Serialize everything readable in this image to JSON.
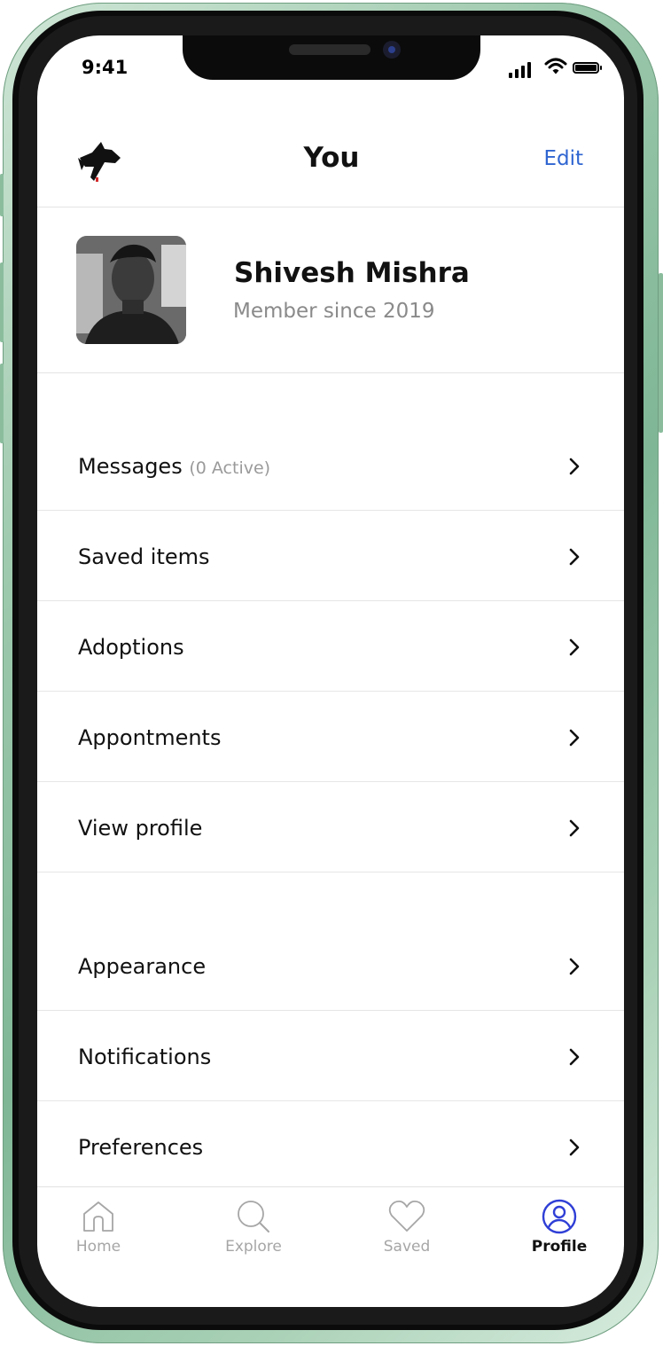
{
  "status_bar": {
    "time": "9:41"
  },
  "header": {
    "title": "You",
    "edit_label": "Edit"
  },
  "profile": {
    "name": "Shivesh Mishra",
    "member_since": "Member since  2019"
  },
  "menu_primary": [
    {
      "label": "Messages",
      "sub": "(0 Active)"
    },
    {
      "label": "Saved items"
    },
    {
      "label": "Adoptions"
    },
    {
      "label": "Appontments"
    },
    {
      "label": "View profile"
    }
  ],
  "menu_secondary": [
    {
      "label": "Appearance"
    },
    {
      "label": "Notifications"
    },
    {
      "label": "Preferences"
    }
  ],
  "tabbar": {
    "active": "Profile",
    "active_color": "#2f3fd6",
    "tabs": [
      {
        "label": "Home",
        "icon": "home-icon"
      },
      {
        "label": "Explore",
        "icon": "search-icon"
      },
      {
        "label": "Saved",
        "icon": "heart-icon"
      },
      {
        "label": "Profile",
        "icon": "user-circle-icon"
      }
    ]
  },
  "colors": {
    "accent": "#2f65d1",
    "muted": "#8a8a8a"
  }
}
